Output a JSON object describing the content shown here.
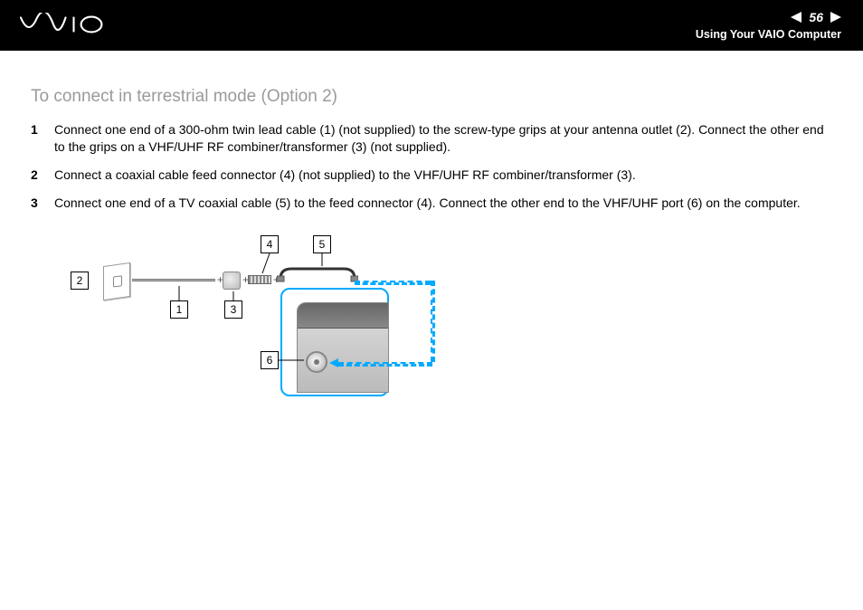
{
  "header": {
    "page_number": "56",
    "section": "Using Your VAIO Computer"
  },
  "title": "To connect in terrestrial mode (Option 2)",
  "steps": [
    {
      "n": "1",
      "text": "Connect one end of a 300-ohm twin lead cable (1) (not supplied) to the screw-type grips at your antenna outlet (2). Connect the other end to the grips on a VHF/UHF RF combiner/transformer (3) (not supplied)."
    },
    {
      "n": "2",
      "text": "Connect a coaxial cable feed connector (4) (not supplied) to the VHF/UHF RF combiner/transformer (3)."
    },
    {
      "n": "3",
      "text": "Connect one end of a TV coaxial cable (5) to the feed connector (4). Connect the other end to the VHF/UHF port (6) on the computer."
    }
  ],
  "callouts": {
    "c1": "1",
    "c2": "2",
    "c3": "3",
    "c4": "4",
    "c5": "5",
    "c6": "6"
  }
}
